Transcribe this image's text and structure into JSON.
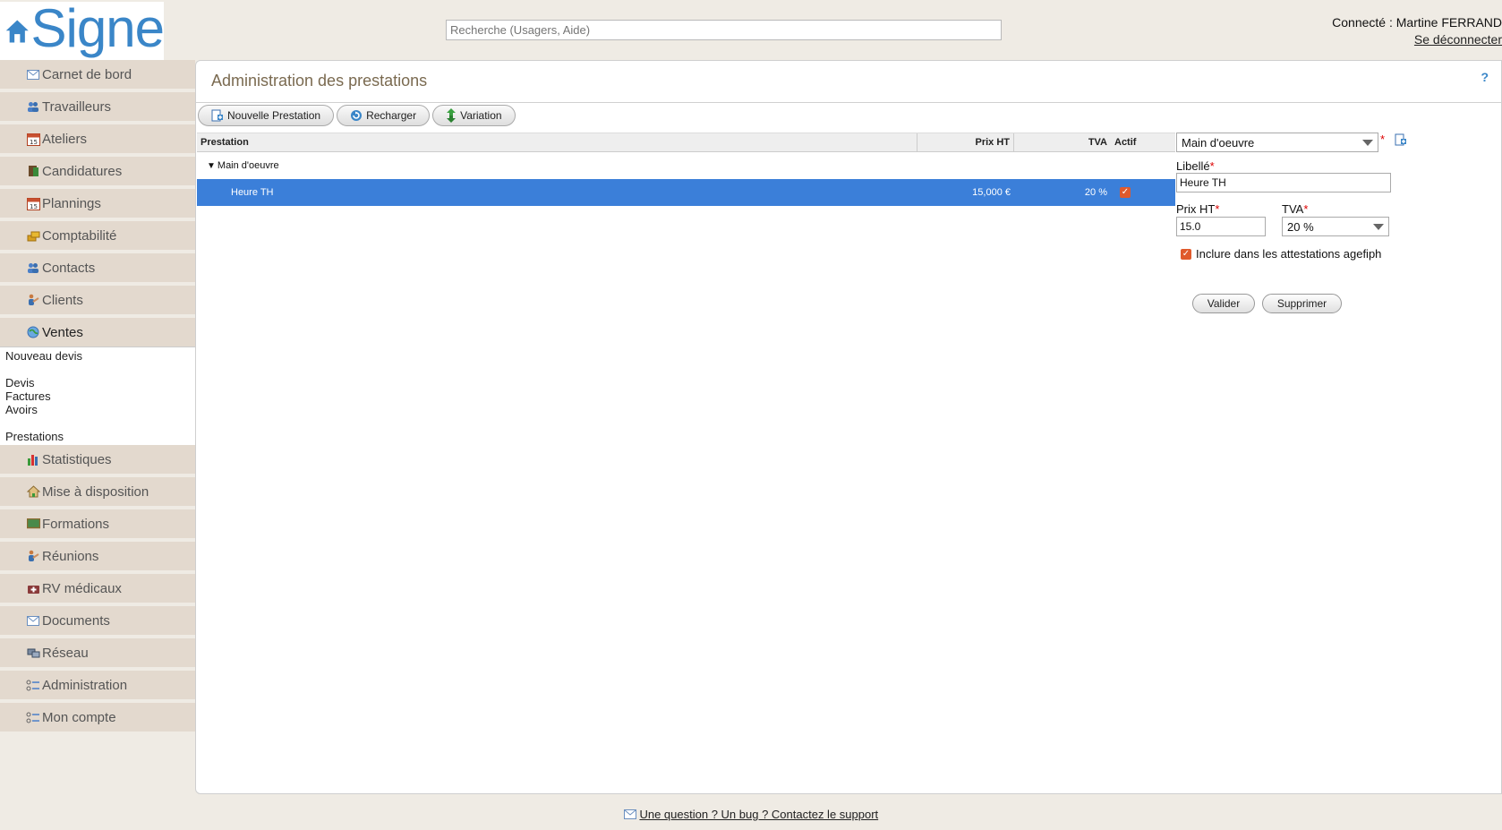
{
  "header": {
    "logo_text": "Signe",
    "search_placeholder": "Recherche (Usagers, Aide)",
    "connected_label": "Connecté : Martine FERRAND",
    "logout_label": "Se déconnecter"
  },
  "sidebar": {
    "items_top": [
      {
        "label": "Carnet de bord",
        "icon": "envelope-icon"
      },
      {
        "label": "Travailleurs",
        "icon": "users-icon"
      },
      {
        "label": "Ateliers",
        "icon": "calendar-icon"
      },
      {
        "label": "Candidatures",
        "icon": "book-icon"
      },
      {
        "label": "Plannings",
        "icon": "calendar-icon"
      },
      {
        "label": "Comptabilité",
        "icon": "coins-icon"
      },
      {
        "label": "Contacts",
        "icon": "users-icon"
      },
      {
        "label": "Clients",
        "icon": "handshake-icon"
      },
      {
        "label": "Ventes",
        "icon": "globe-icon"
      }
    ],
    "ventes_sub": [
      "Nouveau devis",
      "Devis",
      "Factures",
      "Avoirs",
      "Prestations"
    ],
    "items_bottom": [
      {
        "label": "Statistiques",
        "icon": "bar-chart-icon"
      },
      {
        "label": "Mise à disposition",
        "icon": "house-icon"
      },
      {
        "label": "Formations",
        "icon": "board-icon"
      },
      {
        "label": "Réunions",
        "icon": "handshake-icon"
      },
      {
        "label": "RV médicaux",
        "icon": "medical-icon"
      },
      {
        "label": "Documents",
        "icon": "envelope-icon"
      },
      {
        "label": "Réseau",
        "icon": "network-icon"
      },
      {
        "label": "Administration",
        "icon": "settings-list-icon"
      },
      {
        "label": "Mon compte",
        "icon": "settings-list-icon"
      }
    ]
  },
  "main": {
    "title": "Administration des prestations",
    "help": "?",
    "toolbar": {
      "new_label": "Nouvelle Prestation",
      "reload_label": "Recharger",
      "variation_label": "Variation"
    },
    "grid": {
      "columns": [
        "Prestation",
        "Prix HT",
        "TVA",
        "Actif"
      ],
      "group": "Main d'oeuvre",
      "rows": [
        {
          "name": "Heure TH",
          "price": "15,000 €",
          "tva": "20 %",
          "active": true
        }
      ]
    },
    "form": {
      "category_value": "Main d'oeuvre",
      "libelle_label": "Libellé",
      "libelle_value": "Heure TH",
      "prix_label": "Prix HT",
      "prix_value": "15.0",
      "tva_label": "TVA",
      "tva_value": "20 %",
      "agefiph_label": "Inclure dans les attestations agefiph",
      "valider_label": "Valider",
      "supprimer_label": "Supprimer",
      "required_mark": "*"
    }
  },
  "footer": {
    "support_label": "Une question ? Un bug ? Contactez le support"
  },
  "colors": {
    "selected_row": "#3b7fd9",
    "sidebar_item": "#e3d9ce",
    "accent": "#3a86c8",
    "checkbox": "#e05a2c"
  }
}
